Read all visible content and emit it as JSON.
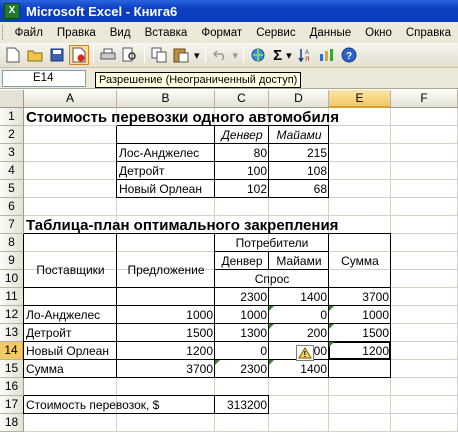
{
  "window": {
    "title": "Microsoft Excel - Книга6",
    "app_icon": "excel-icon"
  },
  "menu": [
    "Файл",
    "Правка",
    "Вид",
    "Вставка",
    "Формат",
    "Сервис",
    "Данные",
    "Окно",
    "Справка"
  ],
  "toolbar": {
    "buttons": [
      "new-icon",
      "open-icon",
      "save-icon",
      "permission-icon",
      "print-icon",
      "print-preview-icon",
      "copy-icon",
      "paste-icon",
      "undo-icon",
      "hyperlink-icon",
      "autosum-icon",
      "sort-icon",
      "chart-icon",
      "help-icon"
    ],
    "sigma_label": "Σ"
  },
  "formula_bar": {
    "name_box": "E14",
    "tooltip": "Разрешение (Неограниченный доступ)"
  },
  "columns": [
    "A",
    "B",
    "C",
    "D",
    "E",
    "F"
  ],
  "rows": [
    "1",
    "2",
    "3",
    "4",
    "5",
    "6",
    "7",
    "8",
    "9",
    "10",
    "11",
    "12",
    "13",
    "14",
    "15",
    "16",
    "17",
    "18"
  ],
  "selected_cell": "E14",
  "sheet": {
    "title1": "Стоимость перевозки одного автомобиля",
    "cost_table": {
      "headers": [
        "Денвер",
        "Майами"
      ],
      "rows": [
        {
          "name": "Лос-Анджелес",
          "values": [
            "80",
            "215"
          ]
        },
        {
          "name": "Детройт",
          "values": [
            "100",
            "108"
          ]
        },
        {
          "name": "Новый Орлеан",
          "values": [
            "102",
            "68"
          ]
        }
      ]
    },
    "title2": "Таблица-план оптимального закрепления",
    "plan_table": {
      "consumers": "Потребители",
      "col_denver": "Денвер",
      "col_miami": "Майами",
      "suppliers": "Поставщики",
      "supply": "Предложение",
      "sum": "Сумма",
      "demand": "Спрос",
      "demand_values": [
        "2300",
        "1400",
        "3700"
      ],
      "rows": [
        {
          "name": "Ло-Анджелес",
          "supply": "1000",
          "denver": "1000",
          "miami": "0",
          "sum": "1000"
        },
        {
          "name": "Детройт",
          "supply": "1500",
          "denver": "1300",
          "miami": "200",
          "sum": "1500"
        },
        {
          "name": "Новый Орлеан",
          "supply": "1200",
          "denver": "0",
          "miami": "00",
          "sum": "1200"
        }
      ],
      "total_row": {
        "name": "Сумма",
        "supply": "3700",
        "denver": "2300",
        "miami": "1400"
      }
    },
    "cost_label": "Стоимость перевозок, $",
    "cost_value": "313200"
  }
}
